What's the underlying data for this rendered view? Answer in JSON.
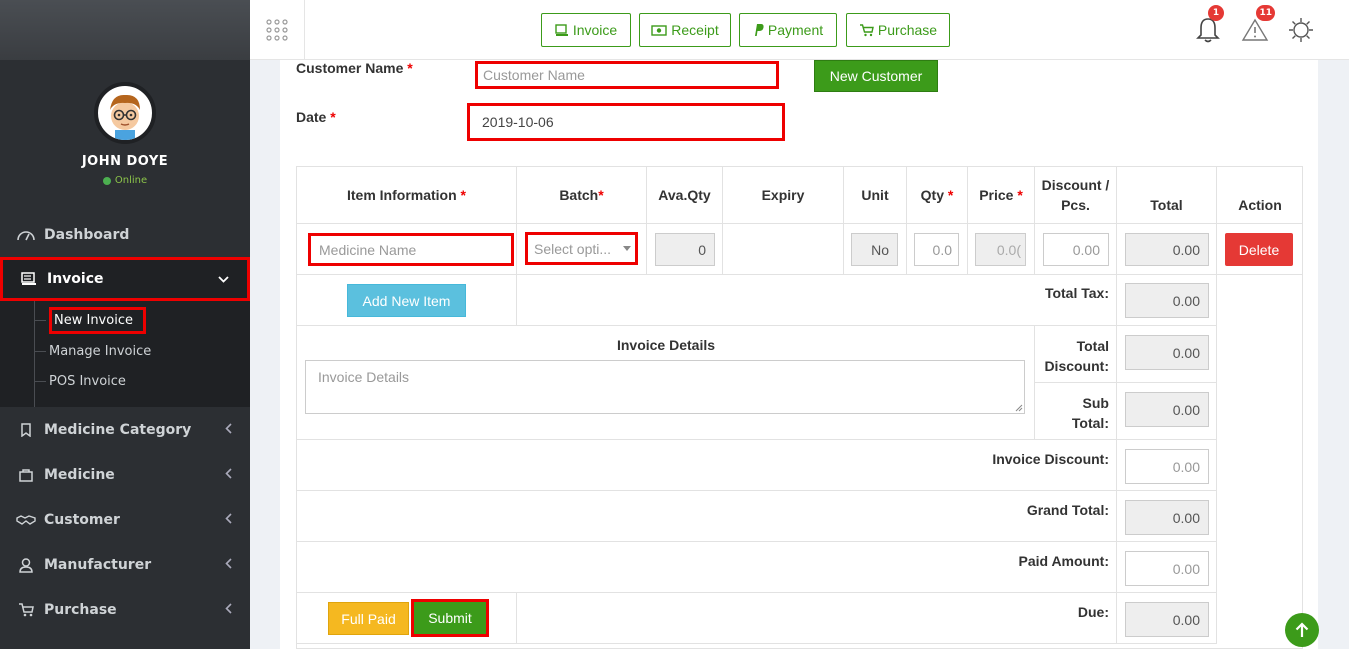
{
  "profile": {
    "name": "JOHN DOYE",
    "status": "Online"
  },
  "sidebar": {
    "items": [
      {
        "label": "Dashboard",
        "icon": "dashboard-icon"
      },
      {
        "label": "Invoice",
        "icon": "invoice-icon"
      },
      {
        "label": "Medicine Category",
        "icon": "bookmark-icon"
      },
      {
        "label": "Medicine",
        "icon": "bag-icon"
      },
      {
        "label": "Customer",
        "icon": "handshake-icon"
      },
      {
        "label": "Manufacturer",
        "icon": "user-icon"
      },
      {
        "label": "Purchase",
        "icon": "cart-icon"
      }
    ],
    "invoice_sub": [
      "New Invoice",
      "Manage Invoice",
      "POS Invoice"
    ]
  },
  "header": {
    "buttons": [
      "Invoice",
      "Receipt",
      "Payment",
      "Purchase"
    ],
    "notifications_count": "1",
    "alerts_count": "11"
  },
  "form": {
    "customer_label": "Customer Name",
    "customer_placeholder": "Customer Name",
    "new_customer": "New Customer",
    "date_label": "Date",
    "date_value": "2019-10-06",
    "required_mark": "*"
  },
  "table": {
    "headers": {
      "item": "Item Information",
      "batch": "Batch",
      "ava_qty": "Ava.Qty",
      "expiry": "Expiry",
      "unit": "Unit",
      "qty": "Qty",
      "price": "Price",
      "discount": "Discount / Pcs.",
      "total": "Total",
      "action": "Action"
    },
    "row": {
      "medicine_placeholder": "Medicine Name",
      "batch_placeholder": "Select opti...",
      "ava_qty": "0",
      "unit": "No",
      "qty": "0.0",
      "price": "0.0(",
      "discount": "0.00",
      "total": "0.00",
      "delete": "Delete"
    },
    "add_new_item": "Add New Item",
    "invoice_details_label": "Invoice Details",
    "invoice_details_placeholder": "Invoice Details",
    "summary": {
      "total_tax_label": "Total Tax:",
      "total_tax": "0.00",
      "total_discount_label": "Total Discount:",
      "total_discount": "0.00",
      "sub_total_label": "Sub Total:",
      "sub_total": "0.00",
      "invoice_discount_label": "Invoice Discount:",
      "invoice_discount": "0.00",
      "grand_total_label": "Grand Total:",
      "grand_total": "0.00",
      "paid_amount_label": "Paid Amount:",
      "paid_amount": "0.00",
      "due_label": "Due:",
      "due": "0.00"
    },
    "full_paid": "Full Paid",
    "submit": "Submit"
  }
}
